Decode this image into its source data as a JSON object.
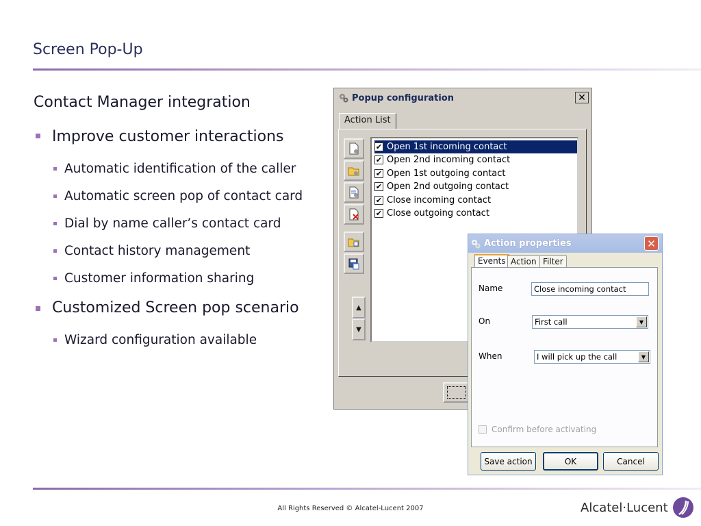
{
  "slide": {
    "title": "Screen Pop-Up",
    "heading": "Contact Manager integration",
    "bullets": [
      {
        "text": "Improve customer interactions",
        "sub": [
          "Automatic identification of the caller",
          "Automatic screen pop of contact card",
          "Dial by name caller’s contact card",
          "Contact history management",
          "Customer information sharing"
        ]
      },
      {
        "text": "Customized Screen pop scenario",
        "sub": [
          "Wizard configuration available"
        ]
      }
    ],
    "footer": "All Rights Reserved © Alcatel-Lucent 2007",
    "logo_text": "Alcatel·Lucent"
  },
  "popup_config": {
    "title": "Popup configuration",
    "tab_label": "Action List",
    "actions": [
      {
        "label": "Open 1st incoming contact",
        "checked": true,
        "selected": true
      },
      {
        "label": "Open 2nd incoming contact",
        "checked": true,
        "selected": false
      },
      {
        "label": "Open 1st outgoing contact",
        "checked": true,
        "selected": false
      },
      {
        "label": "Open 2nd outgoing contact",
        "checked": true,
        "selected": false
      },
      {
        "label": "Close incoming contact",
        "checked": true,
        "selected": false
      },
      {
        "label": "Close outgoing contact",
        "checked": true,
        "selected": false
      }
    ],
    "toolbar_icons": [
      "new-action-icon",
      "open-action-icon",
      "edit-action-icon",
      "delete-action-icon",
      "import-icon",
      "save-icon"
    ]
  },
  "action_properties": {
    "title": "Action properties",
    "tabs": [
      "Events",
      "Action",
      "Filter"
    ],
    "name_label": "Name",
    "name_value": "Close incoming contact",
    "on_label": "On",
    "on_value": "First call",
    "when_label": "When",
    "when_value": "I will pick up the call",
    "confirm_label": "Confirm before activating",
    "buttons": {
      "save": "Save action",
      "ok": "OK",
      "cancel": "Cancel"
    }
  },
  "colors": {
    "accent": "#9b72b8",
    "selection": "#0a246a"
  }
}
